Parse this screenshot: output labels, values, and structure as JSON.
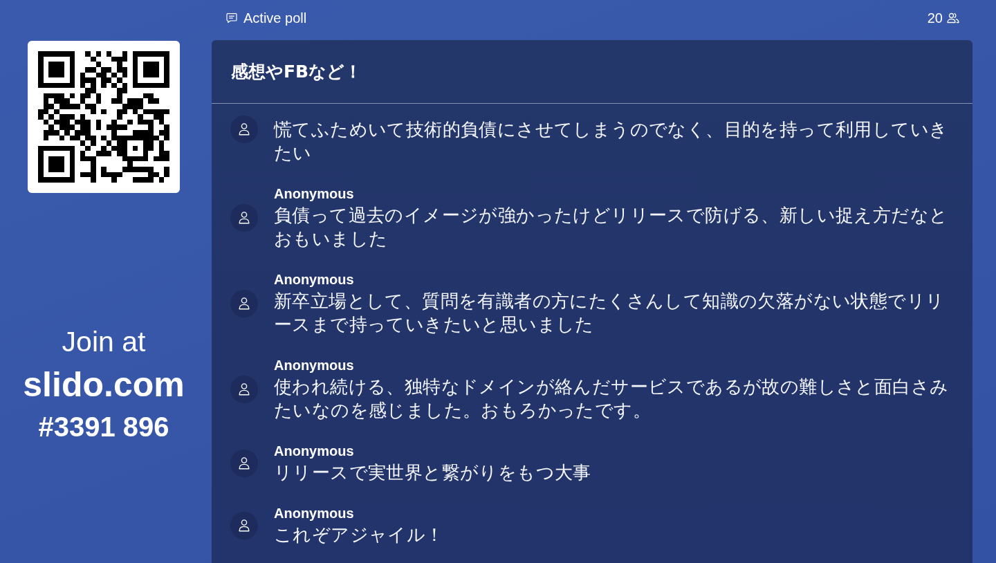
{
  "top_bar": {
    "mode_label": "Active poll",
    "participant_count": "20"
  },
  "join": {
    "prompt": "Join at",
    "site": "slido.com",
    "event_code": "#3391 896"
  },
  "poll": {
    "title": "感想やFBなど！",
    "responses": [
      {
        "text": "慌てふためいて技術的負債にさせてしまうのでなく、目的を持って利用していきたい"
      },
      {
        "author": "Anonymous",
        "text": "負債って過去のイメージが強かったけどリリースで防げる、新しい捉え方だなとおもいました"
      },
      {
        "author": "Anonymous",
        "text": "新卒立場として、質問を有識者の方にたくさんして知識の欠落がない状態でリリースまで持っていきたいと思いました"
      },
      {
        "author": "Anonymous",
        "text": "使われ続ける、独特なドメインが絡んだサービスであるが故の難しさと面白さみたいなのを感じました。おもろかったです。"
      },
      {
        "author": "Anonymous",
        "text": "リリースで実世界と繋がりをもつ大事"
      },
      {
        "author": "Anonymous",
        "text": "これぞアジャイル！"
      }
    ]
  }
}
